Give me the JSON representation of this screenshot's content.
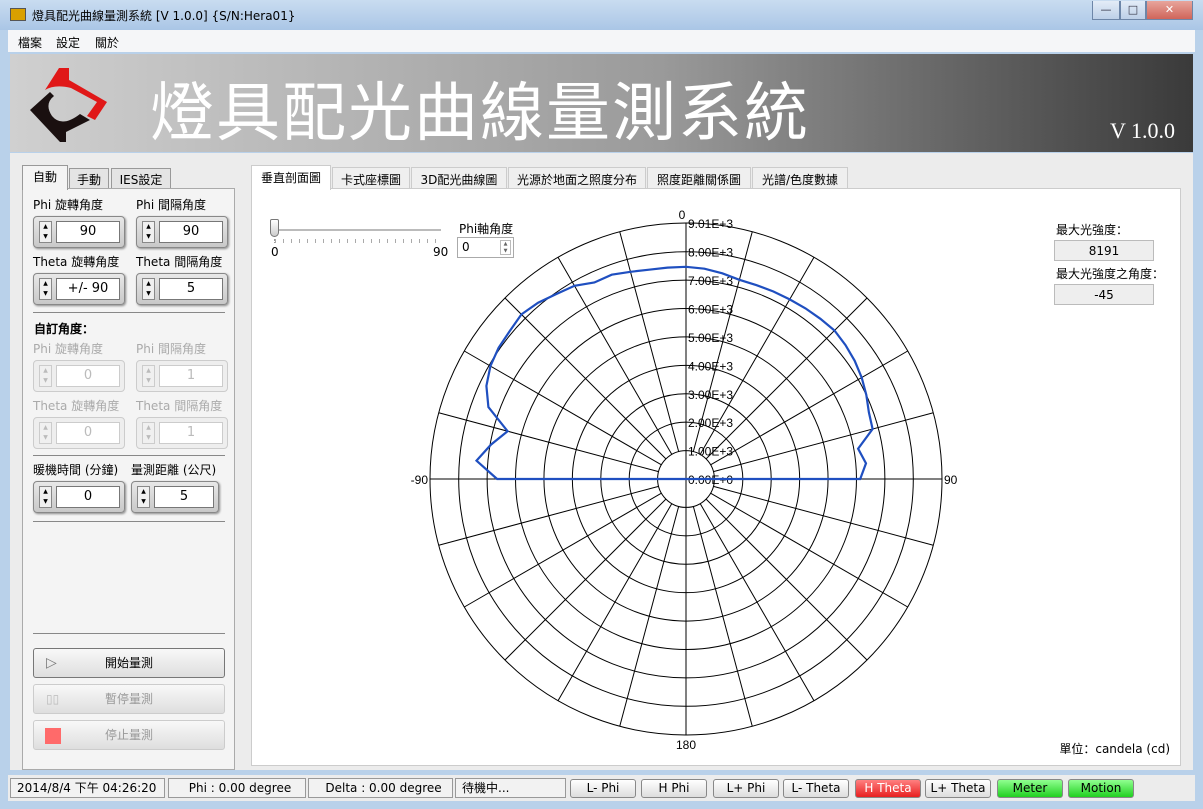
{
  "window": {
    "title": "燈具配光曲線量測系統 [V 1.0.0] {S/N:Hera01}",
    "minimize": "—",
    "maximize": "□",
    "close": "✕"
  },
  "menu": [
    "檔案",
    "設定",
    "關於"
  ],
  "banner": {
    "title": "燈具配光曲線量測系統",
    "version": "V 1.0.0"
  },
  "left_tabs": [
    "自動",
    "手動",
    "IES設定"
  ],
  "auto": {
    "phi_rot_label": "Phi 旋轉角度",
    "phi_rot": "90",
    "phi_int_label": "Phi 間隔角度",
    "phi_int": "90",
    "theta_rot_label": "Theta 旋轉角度",
    "theta_rot": "+/- 90",
    "theta_int_label": "Theta 間隔角度",
    "theta_int": "5",
    "custom_label": "自訂角度：",
    "c_phi_rot_label": "Phi 旋轉角度",
    "c_phi_rot": "0",
    "c_phi_int_label": "Phi 間隔角度",
    "c_phi_int": "1",
    "c_theta_rot_label": "Theta 旋轉角度",
    "c_theta_rot": "0",
    "c_theta_int_label": "Theta 間隔角度",
    "c_theta_int": "1",
    "warmup_label": "暖機時間 (分鐘)",
    "warmup": "0",
    "distance_label": "量測距離 (公尺)",
    "distance": "5"
  },
  "actions": {
    "start": "開始量測",
    "pause": "暫停量測",
    "stop": "停止量測"
  },
  "right_tabs": [
    "垂直剖面圖",
    "卡式座標圖",
    "3D配光曲線圖",
    "光源於地面之照度分布",
    "照度距離關係圖",
    "光譜/色度數據"
  ],
  "slider": {
    "min": "0",
    "max": "90",
    "value": 0
  },
  "phi_axis": {
    "label": "Phi軸角度",
    "value": "0"
  },
  "max_intensity": {
    "label": "最大光強度：",
    "value": "8191"
  },
  "max_angle": {
    "label": "最大光強度之角度：",
    "value": "-45"
  },
  "unit": "單位：candela (cd)",
  "status": {
    "datetime": "2014/8/4 下午 04:26:20",
    "phi": "Phi : 0.00 degree",
    "delta": "Delta : 0.00 degree",
    "state": "待機中..."
  },
  "indicators": [
    {
      "label": "L- Phi",
      "state": "off"
    },
    {
      "label": "H Phi",
      "state": "off"
    },
    {
      "label": "L+ Phi",
      "state": "off"
    },
    {
      "label": "L- Theta",
      "state": "off"
    },
    {
      "label": "H Theta",
      "state": "red"
    },
    {
      "label": "L+ Theta",
      "state": "off"
    },
    {
      "label": "Meter",
      "state": "green"
    },
    {
      "label": "Motion",
      "state": "green"
    }
  ],
  "chart_data": {
    "type": "polar",
    "angle_labels": [
      "0",
      "90",
      "180",
      "-90"
    ],
    "radial_ticks": [
      "0.00E+0",
      "1.00E+3",
      "2.00E+3",
      "3.00E+3",
      "4.00E+3",
      "5.00E+3",
      "6.00E+3",
      "7.00E+3",
      "8.00E+3",
      "9.01E+3"
    ],
    "radial_tick_values": [
      0,
      1000,
      2000,
      3000,
      4000,
      5000,
      6000,
      7000,
      8000,
      9010
    ],
    "rmax": 9010,
    "angle_step_grid": 15,
    "line_color": "#1f4fc0",
    "theta": [
      -90,
      -85,
      -80,
      -75,
      -70,
      -65,
      -60,
      -55,
      -50,
      -45,
      -40,
      -35,
      -30,
      -25,
      -20,
      -15,
      -10,
      -5,
      0,
      5,
      10,
      15,
      20,
      25,
      30,
      35,
      40,
      45,
      50,
      55,
      60,
      65,
      70,
      75,
      80,
      85,
      90
    ],
    "intensity": [
      6650,
      7400,
      6970,
      6500,
      7400,
      7750,
      7950,
      8050,
      8100,
      8191,
      8100,
      7950,
      7850,
      7630,
      7650,
      7550,
      7480,
      7470,
      7470,
      7430,
      7350,
      7260,
      7260,
      7280,
      7300,
      7330,
      7360,
      7390,
      7330,
      7250,
      7140,
      7000,
      6850,
      6800,
      6150,
      6360,
      6130
    ]
  }
}
